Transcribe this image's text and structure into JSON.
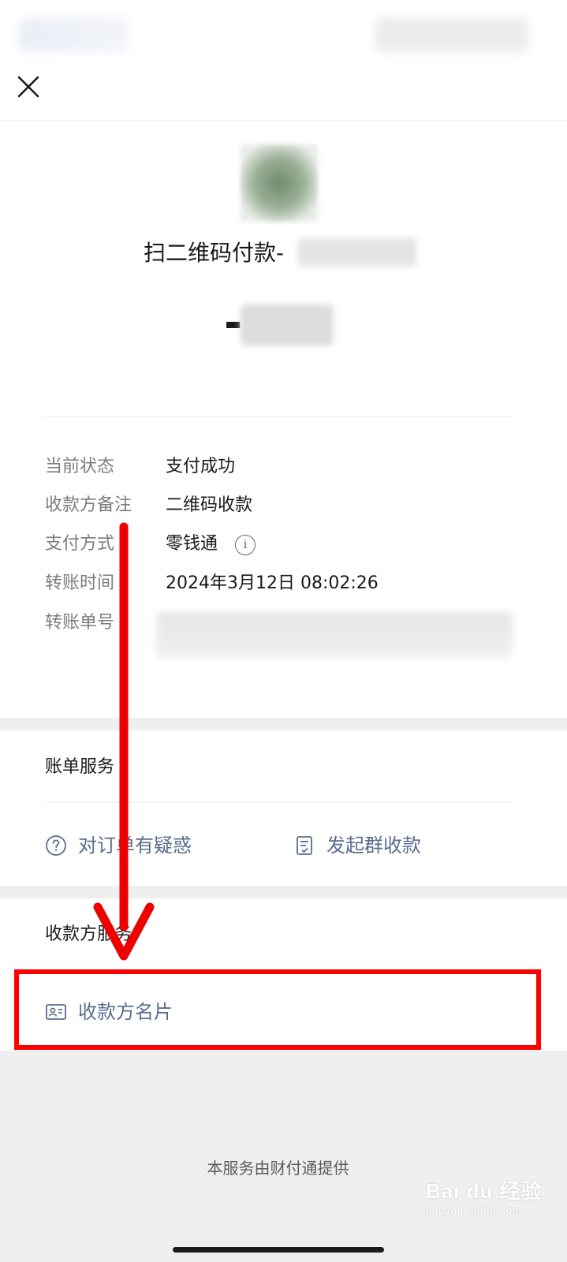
{
  "header": {
    "close_label": "Close"
  },
  "summary": {
    "merchant_prefix": "扫二维码付款-",
    "amount_sign": "-"
  },
  "details": [
    {
      "label": "当前状态",
      "value": "支付成功"
    },
    {
      "label": "收款方备注",
      "value": "二维码收款"
    },
    {
      "label": "支付方式",
      "value": "零钱通"
    },
    {
      "label": "转账时间",
      "value": "2024年3月12日 08:02:26"
    },
    {
      "label": "转账单号",
      "value": ""
    }
  ],
  "bill_services": {
    "title": "账单服务",
    "items": [
      {
        "label": "对订单有疑惑",
        "icon": "question-circle-icon"
      },
      {
        "label": "发起群收款",
        "icon": "document-icon"
      }
    ]
  },
  "payee_services": {
    "title": "收款方服务",
    "items": [
      {
        "label": "收款方名片",
        "icon": "id-card-icon"
      }
    ]
  },
  "footer": {
    "text": "本服务由财付通提供"
  },
  "watermark": {
    "main": "Bai du 经验",
    "sub": "jingyan.baidu.com"
  },
  "colors": {
    "link": "#5a6c8e",
    "annotation": "#ff0000",
    "band": "#efefef"
  }
}
